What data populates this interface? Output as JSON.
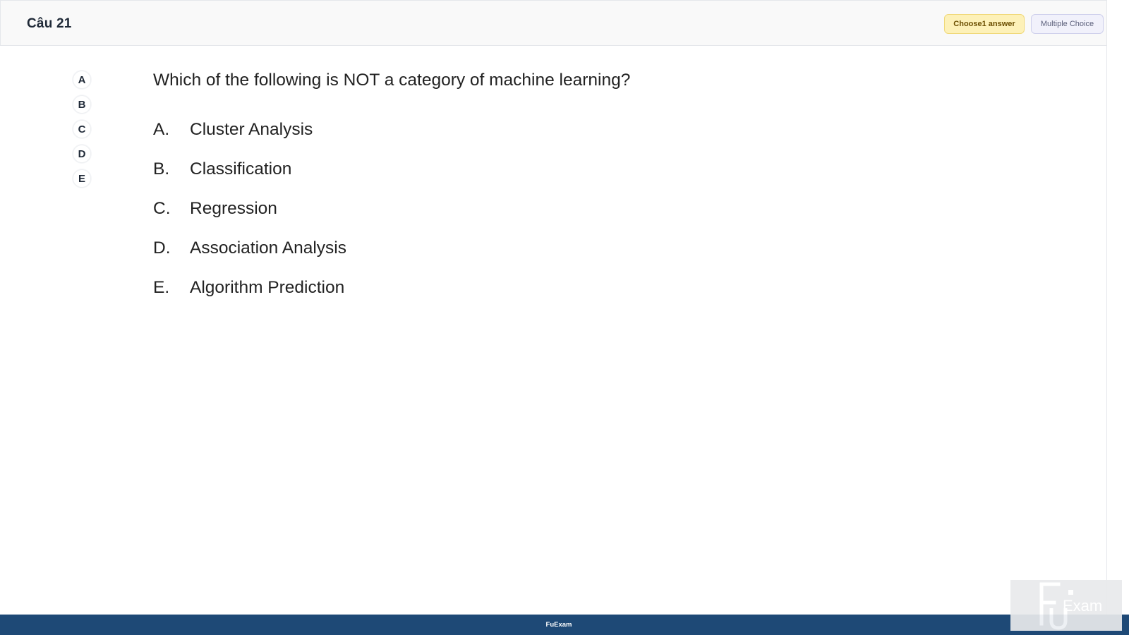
{
  "header": {
    "question_title": "Câu 21",
    "badge_choose": "Choose1 answer",
    "badge_type": "Multiple Choice"
  },
  "side_nav": {
    "items": [
      "A",
      "B",
      "C",
      "D",
      "E"
    ]
  },
  "question": {
    "text": "Which of the following is NOT a category of machine learning?",
    "options": [
      {
        "letter": "A.",
        "text": "Cluster Analysis"
      },
      {
        "letter": "B.",
        "text": "Classification"
      },
      {
        "letter": "C.",
        "text": "Regression"
      },
      {
        "letter": "D.",
        "text": "Association Analysis"
      },
      {
        "letter": "E.",
        "text": "Algorithm Prediction"
      }
    ]
  },
  "footer": {
    "text": "FuExam"
  },
  "watermark": {
    "text": "Exam",
    "icon": "fuexam-logo-icon"
  },
  "colors": {
    "footer_bg": "#1e4976",
    "badge_choose_bg": "#fdf1b8",
    "badge_type_bg": "#f1f1fb"
  }
}
